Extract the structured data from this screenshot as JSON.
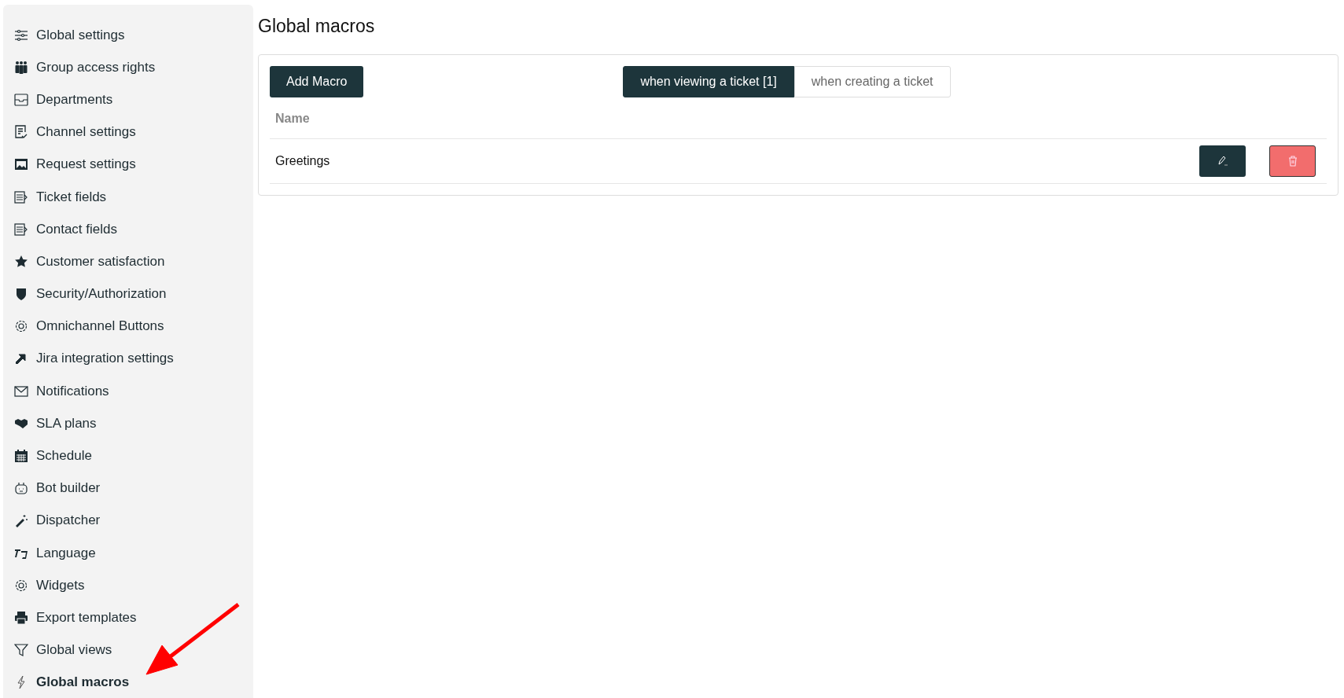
{
  "sidebar": {
    "items": [
      {
        "label": "Global settings",
        "selected": false
      },
      {
        "label": "Group access rights",
        "selected": false
      },
      {
        "label": "Departments",
        "selected": false
      },
      {
        "label": "Channel settings",
        "selected": false
      },
      {
        "label": "Request settings",
        "selected": false
      },
      {
        "label": "Ticket fields",
        "selected": false
      },
      {
        "label": "Contact fields",
        "selected": false
      },
      {
        "label": "Customer satisfaction",
        "selected": false
      },
      {
        "label": "Security/Authorization",
        "selected": false
      },
      {
        "label": "Omnichannel Buttons",
        "selected": false
      },
      {
        "label": "Jira integration settings",
        "selected": false
      },
      {
        "label": "Notifications",
        "selected": false
      },
      {
        "label": "SLA plans",
        "selected": false
      },
      {
        "label": "Schedule",
        "selected": false
      },
      {
        "label": "Bot builder",
        "selected": false
      },
      {
        "label": "Dispatcher",
        "selected": false
      },
      {
        "label": "Language",
        "selected": false
      },
      {
        "label": "Widgets",
        "selected": false
      },
      {
        "label": "Export templates",
        "selected": false
      },
      {
        "label": "Global views",
        "selected": false
      },
      {
        "label": "Global macros",
        "selected": true
      }
    ]
  },
  "page": {
    "title": "Global macros"
  },
  "toolbar": {
    "add_button": "Add Macro",
    "tabs": [
      {
        "label": "when viewing a ticket [1]",
        "selected": true
      },
      {
        "label": "when creating a ticket",
        "selected": false
      }
    ]
  },
  "table": {
    "columns": [
      "Name"
    ],
    "rows": [
      {
        "name": "Greetings"
      }
    ]
  }
}
